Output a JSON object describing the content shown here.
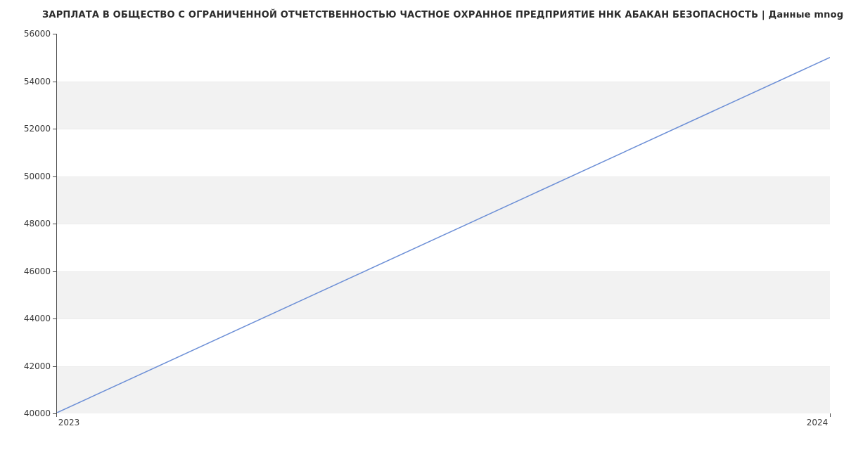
{
  "chart_data": {
    "type": "line",
    "title": "ЗАРПЛАТА В ОБЩЕСТВО С ОГРАНИЧЕННОЙ ОТЧЕТСТВЕННОСТЬЮ ЧАСТНОЕ ОХРАННОЕ ПРЕДПРИЯТИЕ ННК АБАКАН БЕЗОПАСНОСТЬ | Данные mnogo.work",
    "x": [
      2023,
      2024
    ],
    "values": [
      40000,
      55000
    ],
    "xlabel": "",
    "ylabel": "",
    "x_ticks": [
      2023,
      2024
    ],
    "y_ticks": [
      40000,
      42000,
      44000,
      46000,
      48000,
      50000,
      52000,
      54000,
      56000
    ],
    "xlim": [
      2023,
      2024
    ],
    "ylim": [
      40000,
      56000
    ],
    "line_color": "#6b8ed6",
    "alt_band_color": "#f2f2f2"
  }
}
